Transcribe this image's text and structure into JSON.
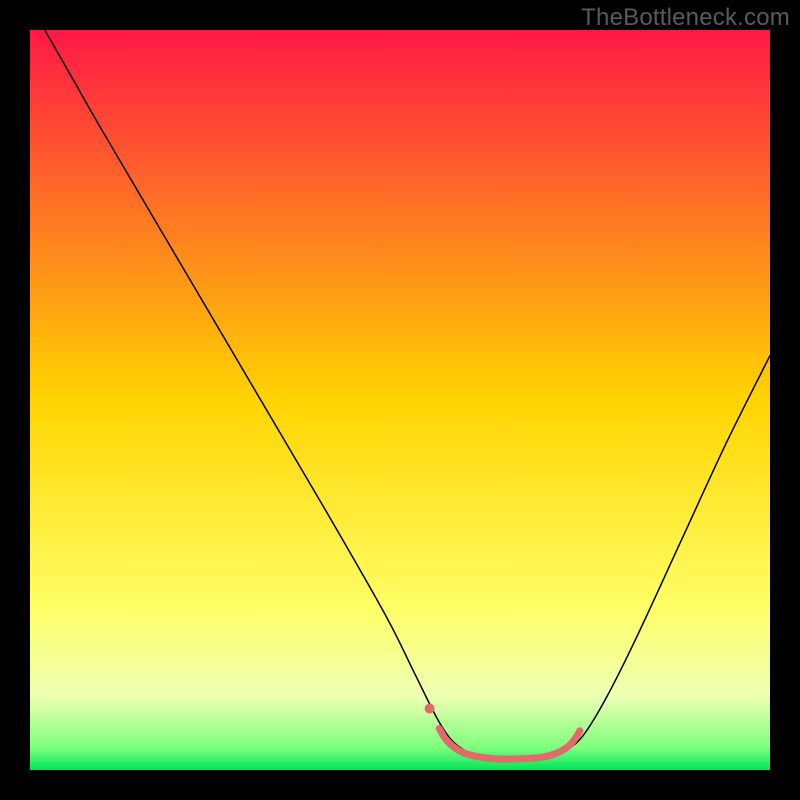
{
  "watermark": {
    "text": "TheBottleneck.com"
  },
  "chart_data": {
    "type": "line",
    "title": "",
    "xlabel": "",
    "ylabel": "",
    "xlim": [
      0,
      100
    ],
    "ylim": [
      0,
      100
    ],
    "background_gradient_stops": [
      {
        "offset": 0,
        "color": "#ff1846"
      },
      {
        "offset": 50,
        "color": "#ffd400"
      },
      {
        "offset": 78,
        "color": "#ffff66"
      },
      {
        "offset": 90,
        "color": "#eeffb3"
      },
      {
        "offset": 97,
        "color": "#7dff7d"
      },
      {
        "offset": 100,
        "color": "#00e65a"
      }
    ],
    "series": [
      {
        "name": "curve",
        "color": "#000000",
        "width": 1.5,
        "points": [
          {
            "x": 2.0,
            "y": 100.0
          },
          {
            "x": 6.0,
            "y": 93.0
          },
          {
            "x": 10.0,
            "y": 86.0
          },
          {
            "x": 20.0,
            "y": 69.0
          },
          {
            "x": 30.0,
            "y": 52.0
          },
          {
            "x": 40.0,
            "y": 35.0
          },
          {
            "x": 48.0,
            "y": 21.0
          },
          {
            "x": 52.0,
            "y": 13.0
          },
          {
            "x": 55.0,
            "y": 7.0
          },
          {
            "x": 57.0,
            "y": 4.0
          },
          {
            "x": 59.0,
            "y": 2.5
          },
          {
            "x": 61.0,
            "y": 1.8
          },
          {
            "x": 64.0,
            "y": 1.5
          },
          {
            "x": 68.0,
            "y": 1.5
          },
          {
            "x": 71.0,
            "y": 2.0
          },
          {
            "x": 73.0,
            "y": 3.0
          },
          {
            "x": 75.0,
            "y": 5.0
          },
          {
            "x": 78.0,
            "y": 10.0
          },
          {
            "x": 82.0,
            "y": 18.0
          },
          {
            "x": 88.0,
            "y": 31.0
          },
          {
            "x": 94.0,
            "y": 44.0
          },
          {
            "x": 100.0,
            "y": 56.0
          }
        ]
      },
      {
        "name": "highlight",
        "color": "#e26a6a",
        "width": 7,
        "points": [
          {
            "x": 55.3,
            "y": 5.6
          },
          {
            "x": 56.3,
            "y": 4.0
          },
          {
            "x": 58.0,
            "y": 2.6
          },
          {
            "x": 60.0,
            "y": 1.9
          },
          {
            "x": 63.0,
            "y": 1.5
          },
          {
            "x": 66.0,
            "y": 1.5
          },
          {
            "x": 69.0,
            "y": 1.7
          },
          {
            "x": 71.0,
            "y": 2.2
          },
          {
            "x": 72.5,
            "y": 3.0
          },
          {
            "x": 73.5,
            "y": 4.0
          },
          {
            "x": 74.3,
            "y": 5.3
          }
        ]
      },
      {
        "name": "highlight-dot",
        "color": "#e26a6a",
        "type": "point",
        "radius": 5,
        "points": [
          {
            "x": 54.0,
            "y": 8.3
          }
        ]
      }
    ]
  }
}
